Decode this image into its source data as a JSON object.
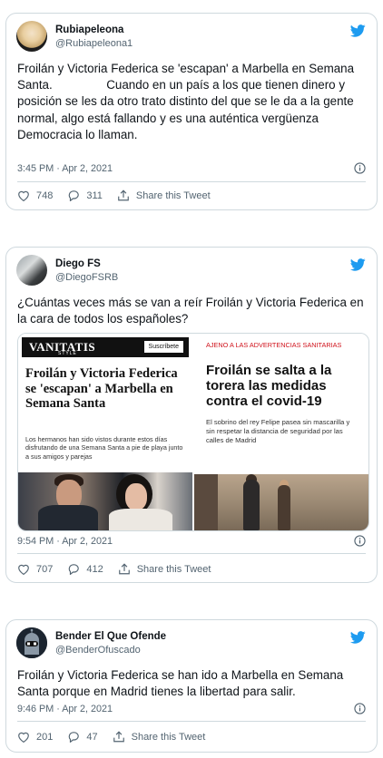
{
  "tweets": [
    {
      "name": "Rubiapeleona",
      "handle": "@Rubiapeleona1",
      "text": "Froilán y Victoria Federica se 'escapan' a Marbella en Semana Santa.                Cuando en un país a los que tienen dinero y posición se les da otro trato distinto del que se le da a la gente normal, algo está fallando y es una auténtica vergüenza\nDemocracia lo llaman.",
      "time": "3:45 PM · Apr 2, 2021",
      "likes": "748",
      "replies": "311",
      "share": "Share this Tweet"
    },
    {
      "name": "Diego FS",
      "handle": "@DiegoFSRB",
      "text": "¿Cuántas veces más se van a reír Froilán y Victoria Federica en la cara de todos los españoles?",
      "time": "9:54 PM · Apr 2, 2021",
      "likes": "707",
      "replies": "412",
      "share": "Share this Tweet",
      "media": {
        "left": {
          "logo": "VANITATIS",
          "logo_sub": "STYLE",
          "subscribe": "Suscríbete",
          "headline": "Froilán y Victoria Federica se 'escapan' a Marbella en Semana Santa",
          "lede": "Los hermanos han sido vistos durante estos días disfrutando de una Semana Santa a pie de playa junto a sus amigos y parejas"
        },
        "right": {
          "kicker": "AJENO A LAS ADVERTENCIAS SANITARIAS",
          "headline": "Froilán se salta a la torera las medidas contra el covid-19",
          "lede": "El sobrino del rey Felipe pasea sin mascarilla y sin respetar la distancia de seguridad por las calles de Madrid"
        }
      }
    },
    {
      "name": "Bender El Que Ofende",
      "handle": "@BenderOfuscado",
      "text": "Froilán y Victoria Federica se han ido a Marbella en Semana Santa porque en Madrid tienes la libertad para salir.",
      "time": "9:46 PM · Apr 2, 2021",
      "likes": "201",
      "replies": "47",
      "share": "Share this Tweet"
    }
  ],
  "colors": {
    "twitter_blue": "#1d9bf0",
    "muted": "#536471",
    "border": "#cfd9de",
    "accent_red": "#d0121b"
  },
  "icons": [
    "twitter-bird-icon",
    "info-icon",
    "heart-icon",
    "reply-icon",
    "share-icon"
  ]
}
